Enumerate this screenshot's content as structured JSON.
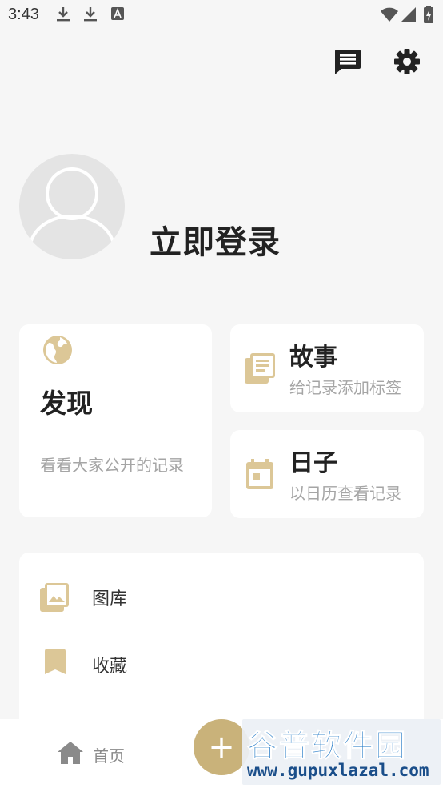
{
  "status_bar": {
    "time": "3:43"
  },
  "header": {
    "message_icon": "chat-icon",
    "settings_icon": "gear-icon"
  },
  "profile": {
    "login_label": "立即登录"
  },
  "cards": {
    "discover": {
      "title": "发现",
      "desc": "看看大家公开的记录"
    },
    "story": {
      "title": "故事",
      "desc": "给记录添加标签"
    },
    "days": {
      "title": "日子",
      "desc": "以日历查看记录"
    }
  },
  "menu": {
    "items": [
      {
        "label": "图库",
        "icon": "gallery-icon"
      },
      {
        "label": "收藏",
        "icon": "bookmark-icon"
      }
    ]
  },
  "bottom_nav": {
    "home_label": "首页",
    "add_label": "+"
  },
  "watermark": {
    "title": "谷普软件园",
    "url": "www.gupuxlazal.com"
  },
  "colors": {
    "accent": "#c9b27a",
    "background": "#f6f6f6",
    "card": "#ffffff"
  }
}
